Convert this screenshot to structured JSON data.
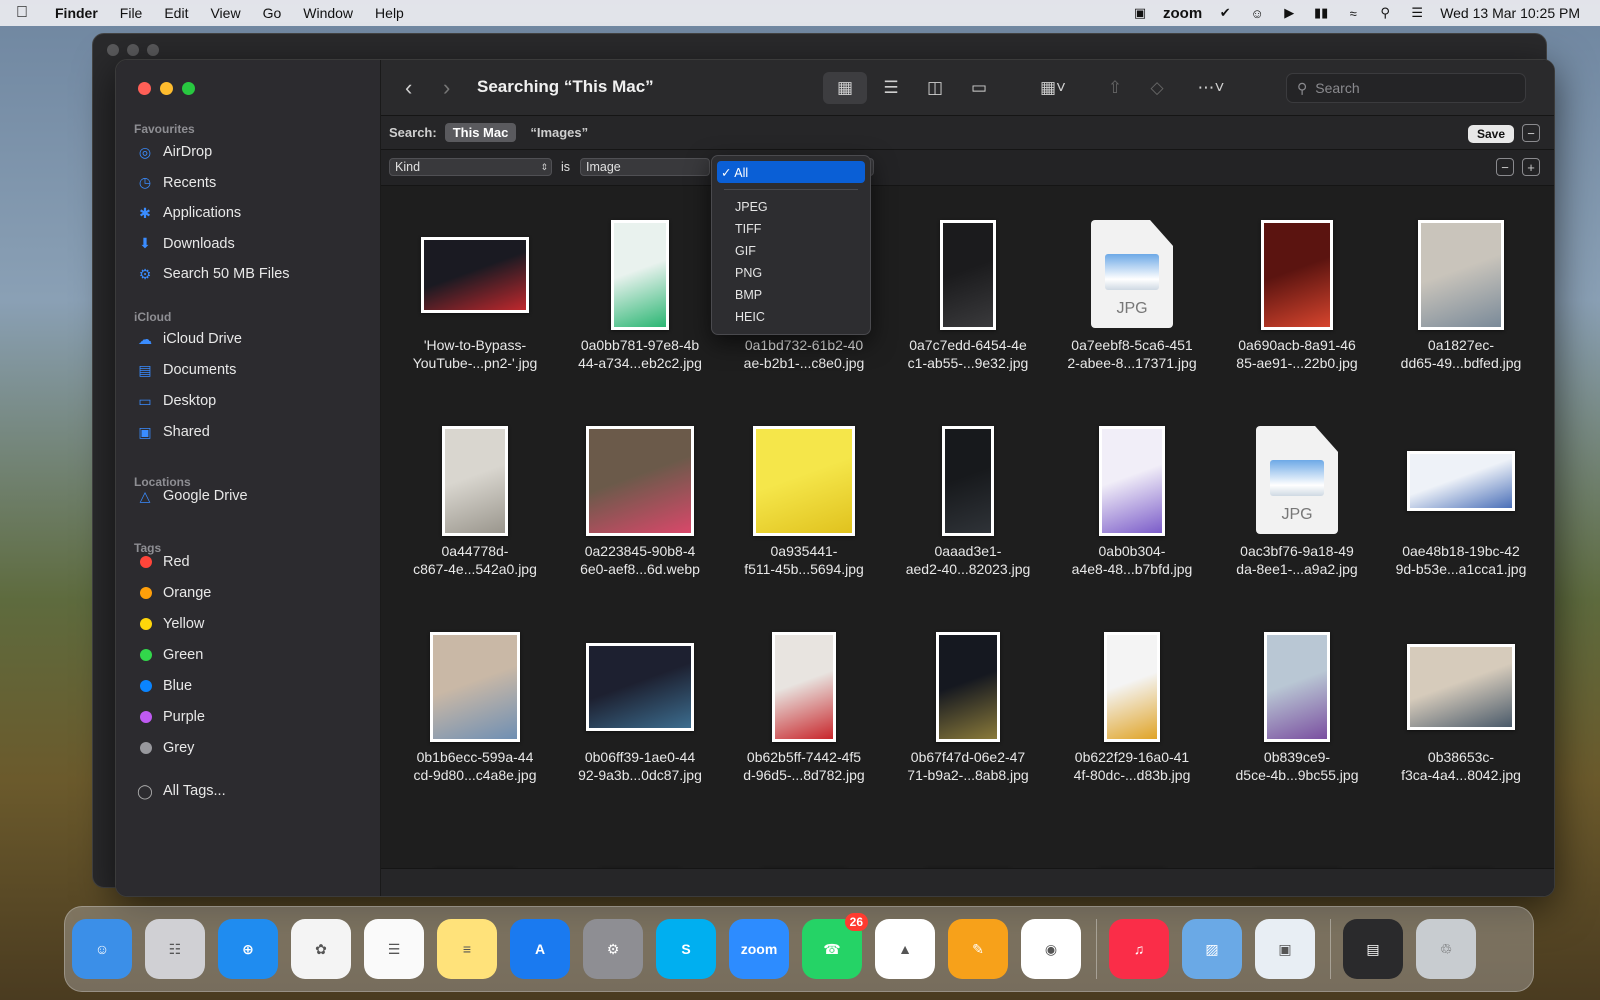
{
  "menubar": {
    "app_name": "Finder",
    "menus": [
      "File",
      "Edit",
      "View",
      "Go",
      "Window",
      "Help"
    ],
    "zoom_label": "zoom",
    "datetime": "Wed 13 Mar  10:25 PM"
  },
  "finder": {
    "title": "Searching “This Mac”",
    "search_placeholder": "Search",
    "sidebar": {
      "favourites_title": "Favourites",
      "favourites": [
        {
          "label": "AirDrop",
          "icon": "airdrop-icon"
        },
        {
          "label": "Recents",
          "icon": "clock-icon"
        },
        {
          "label": "Applications",
          "icon": "applications-icon"
        },
        {
          "label": "Downloads",
          "icon": "download-icon"
        },
        {
          "label": "Search 50 MB Files",
          "icon": "gear-icon"
        }
      ],
      "icloud_title": "iCloud",
      "icloud": [
        {
          "label": "iCloud Drive",
          "icon": "cloud-icon"
        },
        {
          "label": "Documents",
          "icon": "document-icon"
        },
        {
          "label": "Desktop",
          "icon": "desktop-icon"
        },
        {
          "label": "Shared",
          "icon": "shared-folder-icon"
        }
      ],
      "locations_title": "Locations",
      "locations": [
        {
          "label": "Google Drive",
          "icon": "drive-icon"
        }
      ],
      "tags_title": "Tags",
      "tags": [
        {
          "label": "Red",
          "color": "#ff453a"
        },
        {
          "label": "Orange",
          "color": "#ff9f0a"
        },
        {
          "label": "Yellow",
          "color": "#ffd60a"
        },
        {
          "label": "Green",
          "color": "#32d74b"
        },
        {
          "label": "Blue",
          "color": "#0a84ff"
        },
        {
          "label": "Purple",
          "color": "#bf5af2"
        },
        {
          "label": "Grey",
          "color": "#98989d"
        }
      ],
      "all_tags": "All Tags..."
    },
    "scope": {
      "label": "Search:",
      "this_mac": "This Mac",
      "images": "“Images”",
      "save": "Save"
    },
    "criteria": {
      "attribute": "Kind",
      "operator": "is",
      "value": "Image"
    },
    "dropdown": {
      "selected": "✓ All",
      "options": [
        "JPEG",
        "TIFF",
        "GIF",
        "PNG",
        "BMP",
        "HEIC"
      ]
    },
    "files": [
      {
        "line1": "'How-to-Bypass-",
        "line2": "YouTube-...pn2-'.jpg",
        "kind": "photo",
        "colors": [
          "#1a1a22",
          "#c0282d"
        ]
      },
      {
        "line1": "0a0bb781-97e8-4b",
        "line2": "44-a734...eb2c2.jpg",
        "kind": "photo",
        "colors": [
          "#e9f2ee",
          "#2bb673"
        ]
      },
      {
        "line1": "0a1bd732-61b2-40",
        "line2": "ae-b2b1-...c8e0.jpg",
        "kind": "photo",
        "colors": [
          "#2a2a2a",
          "#555"
        ]
      },
      {
        "line1": "0a7c7edd-6454-4e",
        "line2": "c1-ab55-...9e32.jpg",
        "kind": "photo",
        "colors": [
          "#1b1b1d",
          "#3a3a3c"
        ]
      },
      {
        "line1": "0a7eebf8-5ca6-451",
        "line2": "2-abee-8...17371.jpg",
        "kind": "jpgdoc",
        "colors": [
          "#f2f2f2",
          "#6da9e6"
        ]
      },
      {
        "line1": "0a690acb-8a91-46",
        "line2": "85-ae91-...22b0.jpg",
        "kind": "photo",
        "colors": [
          "#5b1410",
          "#d7452e"
        ]
      },
      {
        "line1": "0a1827ec-",
        "line2": "dd65-49...bdfed.jpg",
        "kind": "photo",
        "colors": [
          "#c9c4bb",
          "#7a8a99"
        ]
      },
      {
        "line1": "0a44778d-",
        "line2": "c867-4e...542a0.jpg",
        "kind": "photo",
        "colors": [
          "#d9d6cf",
          "#9a968d"
        ]
      },
      {
        "line1": "0a223845-90b8-4",
        "line2": "6e0-aef8...6d.webp",
        "kind": "photo",
        "colors": [
          "#6b5a4a",
          "#d9486a"
        ]
      },
      {
        "line1": "0a935441-",
        "line2": "f511-45b...5694.jpg",
        "kind": "photo",
        "colors": [
          "#f5e64a",
          "#e0c21e"
        ]
      },
      {
        "line1": "0aaad3e1-",
        "line2": "aed2-40...82023.jpg",
        "kind": "photo",
        "colors": [
          "#17191c",
          "#2f3338"
        ]
      },
      {
        "line1": "0ab0b304-",
        "line2": "a4e8-48...b7bfd.jpg",
        "kind": "photo",
        "colors": [
          "#f1eef8",
          "#7b5cc9"
        ]
      },
      {
        "line1": "0ac3bf76-9a18-49",
        "line2": "da-8ee1-...a9a2.jpg",
        "kind": "jpgdoc",
        "colors": [
          "#f2f2f2",
          "#6da9e6"
        ]
      },
      {
        "line1": "0ae48b18-19bc-42",
        "line2": "9d-b53e...a1cca1.jpg",
        "kind": "photo",
        "colors": [
          "#eef2f8",
          "#4a6fb8"
        ]
      },
      {
        "line1": "0b1b6ecc-599a-44",
        "line2": "cd-9d80...c4a8e.jpg",
        "kind": "photo",
        "colors": [
          "#c9b8a6",
          "#6f8fb3"
        ]
      },
      {
        "line1": "0b06ff39-1ae0-44",
        "line2": "92-9a3b...0dc87.jpg",
        "kind": "photo",
        "colors": [
          "#1d2030",
          "#3c6d8f"
        ]
      },
      {
        "line1": "0b62b5ff-7442-4f5",
        "line2": "d-96d5-...8d782.jpg",
        "kind": "photo",
        "colors": [
          "#e8e4e0",
          "#c8262b"
        ]
      },
      {
        "line1": "0b67f47d-06e2-47",
        "line2": "71-b9a2-...8ab8.jpg",
        "kind": "photo",
        "colors": [
          "#151820",
          "#8a7a3a"
        ]
      },
      {
        "line1": "0b622f29-16a0-41",
        "line2": "4f-80dc-...d83b.jpg",
        "kind": "photo",
        "colors": [
          "#f4f4f4",
          "#e0a428"
        ]
      },
      {
        "line1": "0b839ce9-",
        "line2": "d5ce-4b...9bc55.jpg",
        "kind": "photo",
        "colors": [
          "#b9c7d4",
          "#7a4fa0"
        ]
      },
      {
        "line1": "0b38653c-",
        "line2": "f3ca-4a4...8042.jpg",
        "kind": "photo",
        "colors": [
          "#d6cbbb",
          "#4a5a6a"
        ]
      }
    ],
    "partial_row_colors": [
      "#5a6a3a",
      "#9a9a9a",
      "#6a5a4a",
      "#1d3a22",
      "#5a7a8a",
      "#0a0a0a",
      "#8a7a6a"
    ]
  },
  "dock": {
    "apps": [
      {
        "name": "Finder",
        "icon": "finder-icon",
        "color": "#3b8fe8",
        "glyph": "☺"
      },
      {
        "name": "Launchpad",
        "icon": "launchpad-icon",
        "color": "#d0d0d4",
        "glyph": "☷"
      },
      {
        "name": "Safari",
        "icon": "safari-icon",
        "color": "#1f8cf0",
        "glyph": "⊕"
      },
      {
        "name": "Photos",
        "icon": "photos-icon",
        "color": "#f4f4f4",
        "glyph": "✿"
      },
      {
        "name": "Reminders",
        "icon": "reminders-icon",
        "color": "#fafafa",
        "glyph": "☰"
      },
      {
        "name": "Notes",
        "icon": "notes-icon",
        "color": "#ffe27a",
        "glyph": "≡"
      },
      {
        "name": "App Store",
        "icon": "appstore-icon",
        "color": "#1a7af0",
        "glyph": "A"
      },
      {
        "name": "System Settings",
        "icon": "settings-icon",
        "color": "#8e8e93",
        "glyph": "⚙"
      },
      {
        "name": "Skype",
        "icon": "skype-icon",
        "color": "#00aff0",
        "glyph": "S"
      },
      {
        "name": "Zoom",
        "icon": "zoom-icon",
        "color": "#2d8cff",
        "glyph": "zoom"
      },
      {
        "name": "WhatsApp",
        "icon": "whatsapp-icon",
        "color": "#25d366",
        "glyph": "☎",
        "badge": "26"
      },
      {
        "name": "Google Drive",
        "icon": "drive-icon",
        "color": "#ffffff",
        "glyph": "▲"
      },
      {
        "name": "Pages",
        "icon": "pages-icon",
        "color": "#f7a11a",
        "glyph": "✎"
      },
      {
        "name": "Chrome",
        "icon": "chrome-icon",
        "color": "#ffffff",
        "glyph": "◉"
      }
    ],
    "apps_right": [
      {
        "name": "Music",
        "icon": "music-icon",
        "color": "#fa2d48",
        "glyph": "♫"
      },
      {
        "name": "Preview",
        "icon": "preview-icon",
        "color": "#6aa9e6",
        "glyph": "▨"
      },
      {
        "name": "Preview Document",
        "icon": "preview-doc-icon",
        "color": "#e8eef4",
        "glyph": "▣"
      }
    ],
    "stack": [
      {
        "name": "Recent Window",
        "icon": "window-thumb-icon",
        "color": "#2a2a2c",
        "glyph": "▤"
      },
      {
        "name": "Trash",
        "icon": "trash-icon",
        "color": "#c8ccd0",
        "glyph": "♲"
      }
    ]
  }
}
